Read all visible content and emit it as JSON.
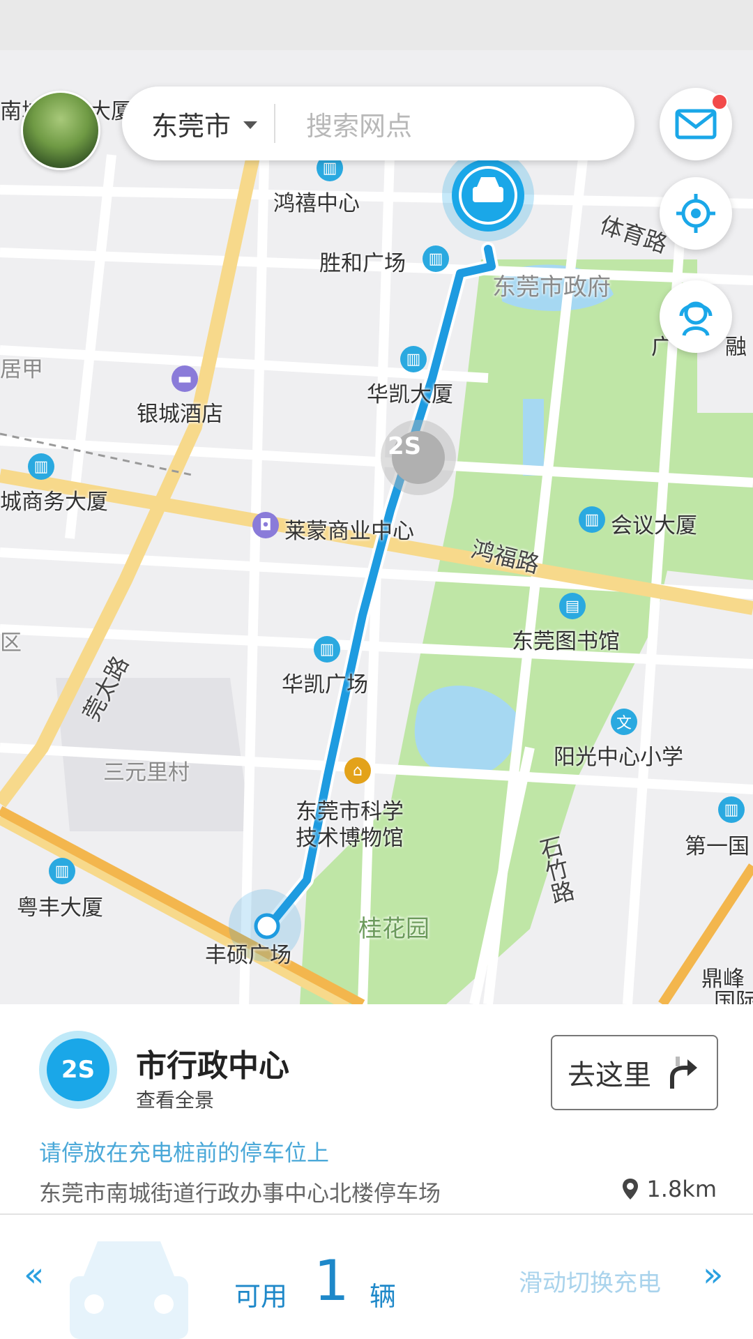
{
  "header": {
    "city": "东莞市",
    "search_placeholder": "搜索网点"
  },
  "map_labels": {
    "hongxi": "鸿禧中心",
    "shenghe": "胜和广场",
    "tiyu_road": "体育路",
    "gov": "东莞市政府",
    "huakai_dasha": "华凯大厦",
    "yincheng_hotel": "银城酒店",
    "laimeng": "莱蒙商业中心",
    "hongfu_road": "鸿福路",
    "huiyi_dasha": "会议大厦",
    "library": "东莞图书馆",
    "huakai_guangchang": "华凯广场",
    "sanyuanli": "三元里村",
    "sunshine_school": "阳光中心小学",
    "science_museum_1": "东莞市科学",
    "science_museum_2": "技术博物馆",
    "shizhu_road": "石竹路",
    "guihuayuan": "桂花园",
    "yuefeng": "粤丰大厦",
    "fengshuo": "丰硕广场",
    "diyi": "第一国",
    "dingfeng_1": "鼎峰",
    "dingfeng_2": "国际",
    "rongfu_road": "莞太路",
    "shangwu": "城商务大厦",
    "jiayuan": "居甲",
    "nancheng": "南城",
    "dasha_top": "大厦",
    "marker_2s": "2S",
    "district_edge": "区",
    "right_edge_1": "广",
    "right_edge_2": "融"
  },
  "station": {
    "badge": "2S",
    "name": "市行政中心",
    "panorama": "查看全景",
    "go_label": "去这里",
    "notice": "请停放在充电桩前的停车位上",
    "address": "东莞市南城街道行政办事中心北楼停车场",
    "distance": "1.8km"
  },
  "availability": {
    "prefix": "可用",
    "count": "1",
    "unit": "辆",
    "swipe_hint": "滑动切换充电",
    "left_arrow": "«",
    "right_arrow": "»"
  },
  "icons": {
    "message": "mail-icon",
    "locate": "locate-icon",
    "service": "customer-service-icon",
    "car": "car-icon",
    "pin": "location-pin-icon",
    "go": "turn-right-arrow-icon"
  },
  "colors": {
    "accent": "#1aa7e8",
    "route": "#1e9be0",
    "park": "#bfe6a6"
  }
}
